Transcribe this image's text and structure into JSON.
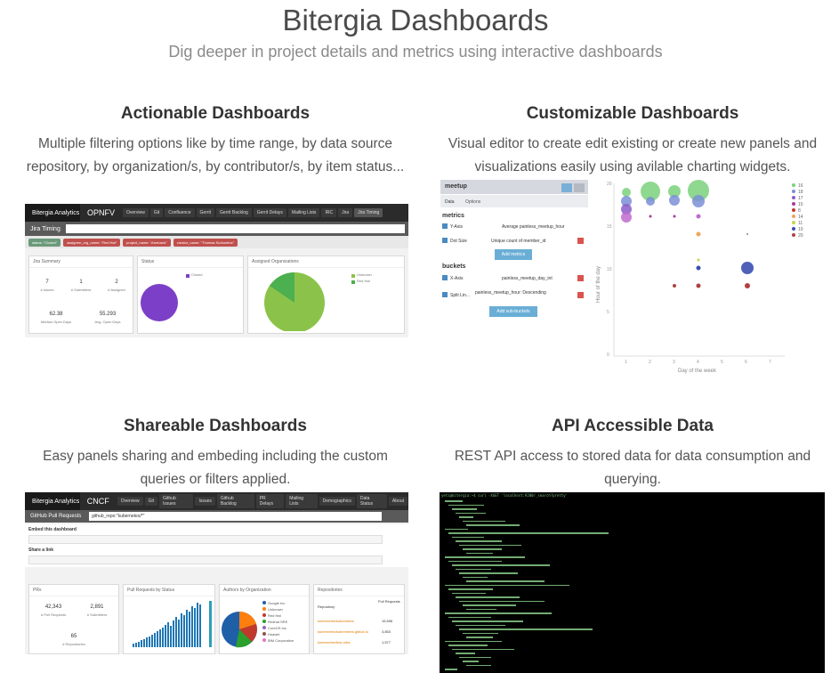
{
  "hero": {
    "title": "Bitergia Dashboards",
    "subtitle": "Dig deeper in project details and metrics using interactive dashboards"
  },
  "features": [
    {
      "title": "Actionable Dashboards",
      "description": "Multiple filtering options like by time range, by data source repository, by organization/s, by contributor/s, by item status..."
    },
    {
      "title": "Customizable Dashboards",
      "description": "Visual editor to create edit existing or create new panels and visualizations easily using avilable charting widgets."
    },
    {
      "title": "Shareable Dashboards",
      "description": "Easy panels sharing and embeding including the custom queries or filters applied."
    },
    {
      "title": "API Accessible Data",
      "description": "REST API access to stored data for data consumption and querying."
    }
  ],
  "shot1": {
    "logo": "Bitergia Analytics",
    "project": "OPNFV",
    "tabs": [
      "Overview",
      "Git",
      "Confluence",
      "Gerrit",
      "Gerrit Backlog",
      "Gerrit Delays",
      "Mailing Lists",
      "IRC",
      "Jira",
      "Jira Timing"
    ],
    "subtitle": "Jira Timing",
    "filters": [
      "status: \"Closed\"",
      "assignee_org_name: \"Red Hat\"",
      "project_name: \"Armband\"",
      "creator_name: \"Thomas Surkontine\""
    ],
    "panels": {
      "summary": "Jira Summary",
      "status": "Status",
      "orgs": "Assigned Organizations"
    },
    "metrics": [
      {
        "value": "7",
        "label": "# Issues"
      },
      {
        "value": "1",
        "label": "# Submitters"
      },
      {
        "value": "2",
        "label": "# Assigned"
      },
      {
        "value": "62.38",
        "label": "Median Open Days"
      },
      {
        "value": "55.293",
        "label": "Avg. Open Days"
      }
    ],
    "status_legend": "Closed",
    "org_legend": [
      "Unknown",
      "Red Hat"
    ],
    "colors": {
      "pie_status": "#7c3fc7",
      "pie_org_main": "#8bc34a",
      "pie_org_slice": "#4caf50"
    }
  },
  "shot2": {
    "editor_title": "meetup",
    "editor_tabs": [
      "Data",
      "Options"
    ],
    "metrics_label": "metrics",
    "buckets_label": "buckets",
    "rows": [
      {
        "label": "Y-Axis",
        "value": "Average painless_meetup_hour"
      },
      {
        "label": "Dot Size",
        "value": "Unique count of member_id"
      },
      {
        "label": "X-Axis",
        "value": "painless_meetup_day_int"
      },
      {
        "label": "Split Lin...",
        "value": "painless_meetup_hour: Descending"
      }
    ],
    "add_metrics": "Add metrics",
    "add_sub_buckets": "Add sub-buckets",
    "xlabel": "Day of the week",
    "ylabel": "Hour of the day",
    "yticks": [
      "20",
      "15",
      "10",
      "5",
      "0"
    ],
    "xticks": [
      "1",
      "2",
      "3",
      "4",
      "5",
      "6",
      "7"
    ],
    "legend": [
      "16",
      "18",
      "17",
      "15",
      "8",
      "14",
      "11",
      "10",
      "20"
    ],
    "legend_colors": [
      "#7bd17b",
      "#7b8fd6",
      "#8b5cc9",
      "#a63b99",
      "#c0392b",
      "#f2a45c",
      "#c9d14f",
      "#3b4fb0",
      "#b04040"
    ]
  },
  "shot3": {
    "logo": "Bitergia Analytics",
    "project": "CNCF",
    "tabs": [
      "Overview",
      "Git",
      "Github Issues",
      "Issues",
      "Github Backlog",
      "PR Delays",
      "Mailing Lists",
      "Demographics",
      "Data Status",
      "About"
    ],
    "search_label": "GitHub Pull Requests",
    "search_value": "github_repo:\"kubernetes/*\"",
    "embed_label": "Embed this dashboard",
    "share_label": "Share a link",
    "panels": {
      "prs": "PRs",
      "status": "Pull Requests by Status",
      "orgs": "Authors by Organization",
      "repos": "Repositories"
    },
    "metrics": [
      {
        "value": "42,343",
        "label": "# Pull Requests"
      },
      {
        "value": "2,891",
        "label": "# Submitters"
      },
      {
        "value": "65",
        "label": "# Repositories"
      }
    ],
    "org_legend": [
      "Google Inc",
      "Unknown",
      "Red Hat",
      "Redhat SRE",
      "CoreOS Inc",
      "Huawei",
      "IBM Corporation"
    ],
    "repo_header": [
      "Repository",
      "Pull Requests"
    ],
    "repos": [
      {
        "name": "kubernetes/kubernetes",
        "count": "15,596"
      },
      {
        "name": "kubernetes/kubernetes.github.io",
        "count": "3,853"
      },
      {
        "name": "kubernetes/test-infra",
        "count": "1,577"
      }
    ]
  },
  "shot4": {
    "header": "yeti@bitergia:~$ curl -XGET 'localhost:9200/_search?pretty'"
  }
}
